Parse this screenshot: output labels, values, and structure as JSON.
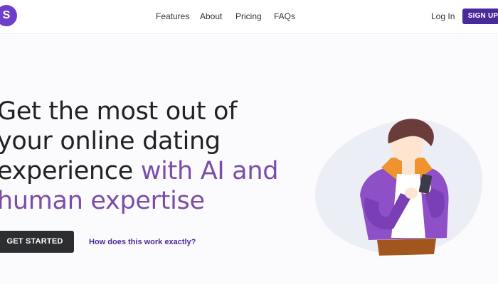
{
  "header": {
    "logo_letter": "S",
    "nav": [
      {
        "label": "Features"
      },
      {
        "label": "About"
      },
      {
        "label": "Pricing"
      },
      {
        "label": "FAQs"
      }
    ],
    "login_label": "Log In",
    "signup_label": "SIGN UP"
  },
  "hero": {
    "line1": "Get the most out of",
    "line2": "your online dating",
    "line3_plain": "experience ",
    "line3_accent": "with AI and",
    "line4_accent": "human expertise",
    "cta_label": "GET STARTED",
    "secondary_link": "How does this work exactly?"
  },
  "colors": {
    "brand_purple": "#4a2a9a",
    "accent_purple": "#7b4ea6",
    "logo_purple": "#6f3fc7",
    "dark_button": "#2c2e31",
    "text_dark": "#222222"
  },
  "icons": {
    "hero_illustration": "person-with-phone-illustration"
  }
}
